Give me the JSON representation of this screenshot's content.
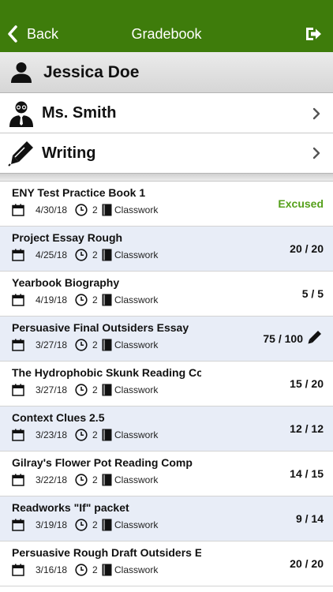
{
  "nav": {
    "back_label": "Back",
    "title": "Gradebook",
    "logout_icon": "logout-icon"
  },
  "student": {
    "name": "Jessica Doe",
    "icon": "person-icon"
  },
  "teacher": {
    "name": "Ms. Smith",
    "icon": "teacher-icon"
  },
  "subject": {
    "name": "Writing",
    "icon": "pen-icon"
  },
  "colors": {
    "nav": "#3e7c0b",
    "excused": "#55a01b",
    "alt_row": "#e8edf7"
  },
  "assignments": [
    {
      "name": "ENY Test Practice Book 1",
      "date": "4/30/18",
      "period": "2",
      "category": "Classwork",
      "score": "Excused"
    },
    {
      "name": "Project Essay Rough",
      "date": "4/25/18",
      "period": "2",
      "category": "Classwork",
      "score": "20 / 20"
    },
    {
      "name": "Yearbook Biography",
      "date": "4/19/18",
      "period": "2",
      "category": "Classwork",
      "score": "5 / 5"
    },
    {
      "name": "Persuasive Final Outsiders Essay",
      "date": "3/27/18",
      "period": "2",
      "category": "Classwork",
      "score": "75 / 100"
    },
    {
      "name": "The Hydrophobic Skunk Reading Com",
      "date": "3/27/18",
      "period": "2",
      "category": "Classwork",
      "score": "15 / 20"
    },
    {
      "name": "Context Clues 2.5",
      "date": "3/23/18",
      "period": "2",
      "category": "Classwork",
      "score": "12 / 12"
    },
    {
      "name": "Gilray's Flower Pot Reading Comp",
      "date": "3/22/18",
      "period": "2",
      "category": "Classwork",
      "score": "14 / 15"
    },
    {
      "name": "Readworks \"If\" packet",
      "date": "3/19/18",
      "period": "2",
      "category": "Classwork",
      "score": "9 / 14"
    },
    {
      "name": "Persuasive Rough Draft Outsiders Essay",
      "date": "3/16/18",
      "period": "2",
      "category": "Classwork",
      "score": "20 / 20"
    }
  ]
}
